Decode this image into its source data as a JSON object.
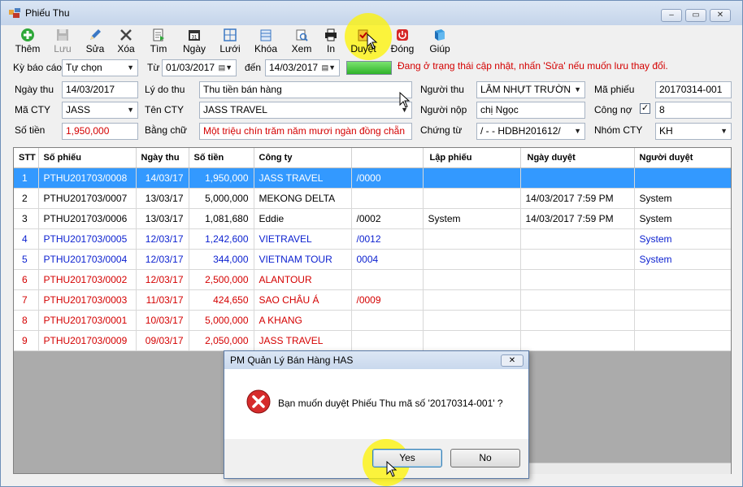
{
  "window": {
    "title": "Phiếu Thu",
    "controls": [
      "–",
      "▭",
      "✕"
    ]
  },
  "toolbar": [
    {
      "label": "Thêm",
      "icon": "plus-circle-icon",
      "enabled": true
    },
    {
      "label": "Lưu",
      "icon": "floppy-disk-icon",
      "enabled": false
    },
    {
      "label": "Sửa",
      "icon": "pencil-icon",
      "enabled": true
    },
    {
      "label": "Xóa",
      "icon": "delete-x-icon",
      "enabled": true
    },
    {
      "label": "Tìm",
      "icon": "find-document-icon",
      "enabled": true
    },
    {
      "label": "Ngày",
      "icon": "calendar-icon",
      "enabled": true
    },
    {
      "label": "Lưới",
      "icon": "grid-icon",
      "enabled": true
    },
    {
      "label": "Khóa",
      "icon": "lock-icon",
      "enabled": true
    },
    {
      "label": "Xem",
      "icon": "preview-icon",
      "enabled": true
    },
    {
      "label": "In",
      "icon": "printer-icon",
      "enabled": true
    },
    {
      "label": "Duyệt",
      "icon": "approve-icon",
      "enabled": true
    },
    {
      "label": "Đóng",
      "icon": "power-icon",
      "enabled": true
    },
    {
      "label": "Giúp",
      "icon": "help-book-icon",
      "enabled": true
    }
  ],
  "filter": {
    "ky_bao_cao_label": "Kỳ báo cáo",
    "ky_bao_cao_value": "Tự chọn",
    "tu_label": "Từ",
    "tu_value": "01/03/2017",
    "den_label": "đến",
    "den_value": "14/03/2017",
    "progress": 1.0,
    "status_message": "Đang ở trạng thái cập nhật, nhấn 'Sửa' nếu muốn lưu thay đổi."
  },
  "form": {
    "ngay_thu_label": "Ngày thu",
    "ngay_thu_value": "14/03/2017",
    "ly_do_thu_label": "Lý do thu",
    "ly_do_thu_value": "Thu tiền bán hàng",
    "nguoi_thu_label": "Người thu",
    "nguoi_thu_value": "LÂM NHỰT TRƯỜN",
    "ma_phieu_label": "Mã phiếu",
    "ma_phieu_value": "20170314-001",
    "ma_cty_label": "Mã CTY",
    "ma_cty_value": "JASS",
    "ten_cty_label": "Tên CTY",
    "ten_cty_value": "JASS TRAVEL",
    "nguoi_nop_label": "Người nộp",
    "nguoi_nop_value": "chị Ngọc",
    "cong_no_label": "Công nợ",
    "cong_no_checked": true,
    "cong_no_value": "8",
    "so_tien_label": "Số tiền",
    "so_tien_value": "1,950,000",
    "bang_chu_label": "Bằng chữ",
    "bang_chu_value": "Một triệu chín trăm năm mươi ngàn đồng chẵn",
    "chung_tu_label": "Chứng từ",
    "chung_tu_value": "/  -  -  HDBH201612/",
    "nhom_cty_label": "Nhóm CTY",
    "nhom_cty_value": "KH"
  },
  "grid": {
    "columns": [
      "STT",
      "Số phiếu",
      "Ngày thu",
      "Số tiền",
      "Công ty",
      "",
      "Lập phiếu",
      "Ngày duyệt",
      "Người duyệt"
    ],
    "rows": [
      {
        "style": "sel",
        "cells": [
          "1",
          "PTHU201703/0008",
          "14/03/17",
          "1,950,000",
          "JASS TRAVEL",
          "/0000",
          "",
          "",
          ""
        ]
      },
      {
        "style": "black",
        "cells": [
          "2",
          "PTHU201703/0007",
          "13/03/17",
          "5,000,000",
          "MEKONG DELTA",
          "",
          "",
          "14/03/2017 7:59 PM",
          "System"
        ]
      },
      {
        "style": "black",
        "cells": [
          "3",
          "PTHU201703/0006",
          "13/03/17",
          "1,081,680",
          "Eddie",
          "/0002",
          "System",
          "14/03/2017 7:59 PM",
          "System"
        ]
      },
      {
        "style": "blue",
        "cells": [
          "4",
          "PTHU201703/0005",
          "12/03/17",
          "1,242,600",
          "VIETRAVEL",
          "/0012",
          "",
          "",
          "System"
        ]
      },
      {
        "style": "blue",
        "cells": [
          "5",
          "PTHU201703/0004",
          "12/03/17",
          "344,000",
          "VIETNAM TOUR",
          "0004",
          "",
          "",
          "System"
        ]
      },
      {
        "style": "red",
        "cells": [
          "6",
          "PTHU201703/0002",
          "12/03/17",
          "2,500,000",
          "ALANTOUR",
          "",
          "",
          "",
          ""
        ]
      },
      {
        "style": "red",
        "cells": [
          "7",
          "PTHU201703/0003",
          "11/03/17",
          "424,650",
          "SAO CHÂU Á",
          "/0009",
          "",
          "",
          ""
        ]
      },
      {
        "style": "red",
        "cells": [
          "8",
          "PTHU201703/0001",
          "10/03/17",
          "5,000,000",
          "A KHANG",
          "",
          "",
          "",
          ""
        ]
      },
      {
        "style": "red",
        "cells": [
          "9",
          "PTHU201703/0009",
          "09/03/17",
          "2,050,000",
          "JASS TRAVEL",
          "",
          "",
          "",
          ""
        ]
      }
    ]
  },
  "dialog": {
    "title": "PM Quản Lý Bán Hàng HAS",
    "close": "✕",
    "icon": "error-x-icon",
    "message": "Bạn muốn duyệt Phiếu Thu mã số '20170314-001' ?",
    "yes_label": "Yes",
    "no_label": "No"
  },
  "colors": {
    "selection": "#3399ff",
    "approved_text": "#000000",
    "blue_text": "#0a1fcf",
    "red_text": "#d40000",
    "highlight": "#fff400"
  }
}
